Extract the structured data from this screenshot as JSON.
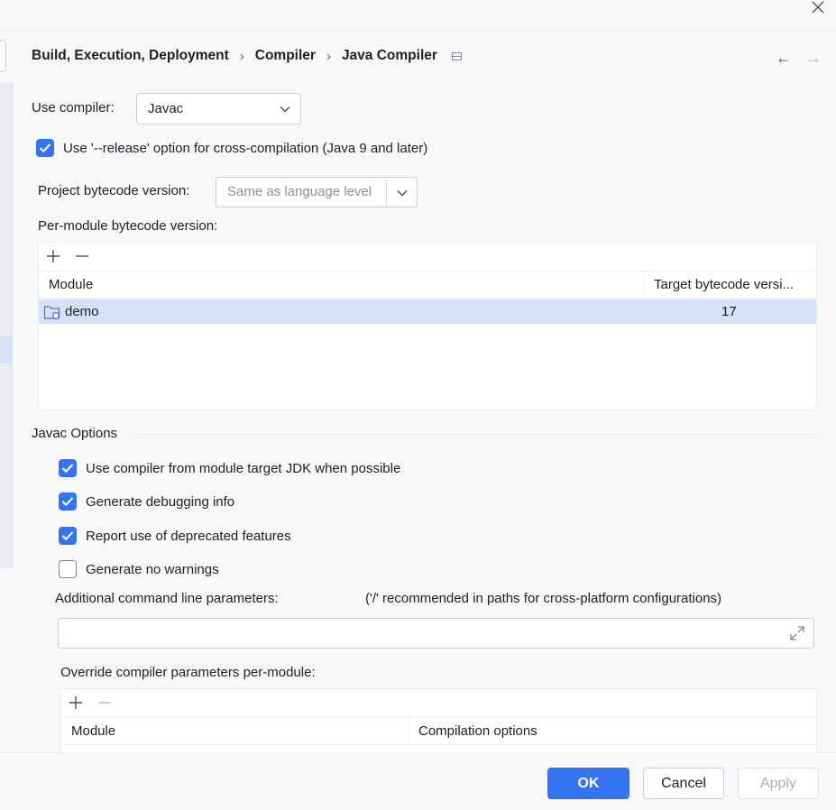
{
  "breadcrumb": {
    "items": [
      "Build, Execution, Deployment",
      "Compiler",
      "Java Compiler"
    ],
    "separator": "›"
  },
  "nav": {
    "back": "←",
    "forward": "→"
  },
  "compiler": {
    "label": "Use compiler:",
    "value": "Javac"
  },
  "release_option": {
    "label": "Use '--release' option for cross-compilation (Java 9 and later)",
    "checked": true
  },
  "bytecode": {
    "label": "Project bytecode version:",
    "placeholder": "Same as language level"
  },
  "per_module": {
    "label": "Per-module bytecode version:",
    "columns": [
      "Module",
      "Target bytecode versi..."
    ],
    "rows": [
      {
        "module": "demo",
        "target": "17",
        "selected": true
      }
    ]
  },
  "javac_options": {
    "title": "Javac Options",
    "checkboxes": [
      {
        "label": "Use compiler from module target JDK when possible",
        "checked": true
      },
      {
        "label": "Generate debugging info",
        "checked": true
      },
      {
        "label": "Report use of deprecated features",
        "checked": true
      },
      {
        "label": "Generate no warnings",
        "checked": false
      }
    ],
    "additional_params_label": "Additional command line parameters:",
    "additional_params_hint": "('/' recommended in paths for cross-platform configurations)",
    "additional_params_value": ""
  },
  "override": {
    "label": "Override compiler parameters per-module:",
    "columns": [
      "Module",
      "Compilation options"
    ]
  },
  "buttons": {
    "ok": "OK",
    "cancel": "Cancel",
    "apply": "Apply"
  },
  "colors": {
    "accent": "#3574f0",
    "selection": "#d5e1f7",
    "background": "#f7f8fa"
  }
}
